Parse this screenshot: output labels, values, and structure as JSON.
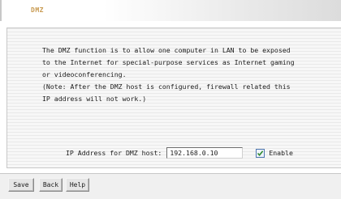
{
  "header": {
    "title": "DMZ"
  },
  "description": {
    "lines": [
      "The DMZ function is to allow one computer in LAN to be exposed",
      "to the Internet for special-purpose services as Internet gaming",
      "or videoconferencing.",
      "(Note: After the DMZ host is configured, firewall related this",
      "IP address will not work.)"
    ]
  },
  "dmz_host": {
    "label": "IP Address for DMZ host:",
    "value": "192.168.0.10",
    "enable_label": "Enable",
    "enabled": true
  },
  "buttons": {
    "save": "Save",
    "back": "Back",
    "help": "Help"
  }
}
